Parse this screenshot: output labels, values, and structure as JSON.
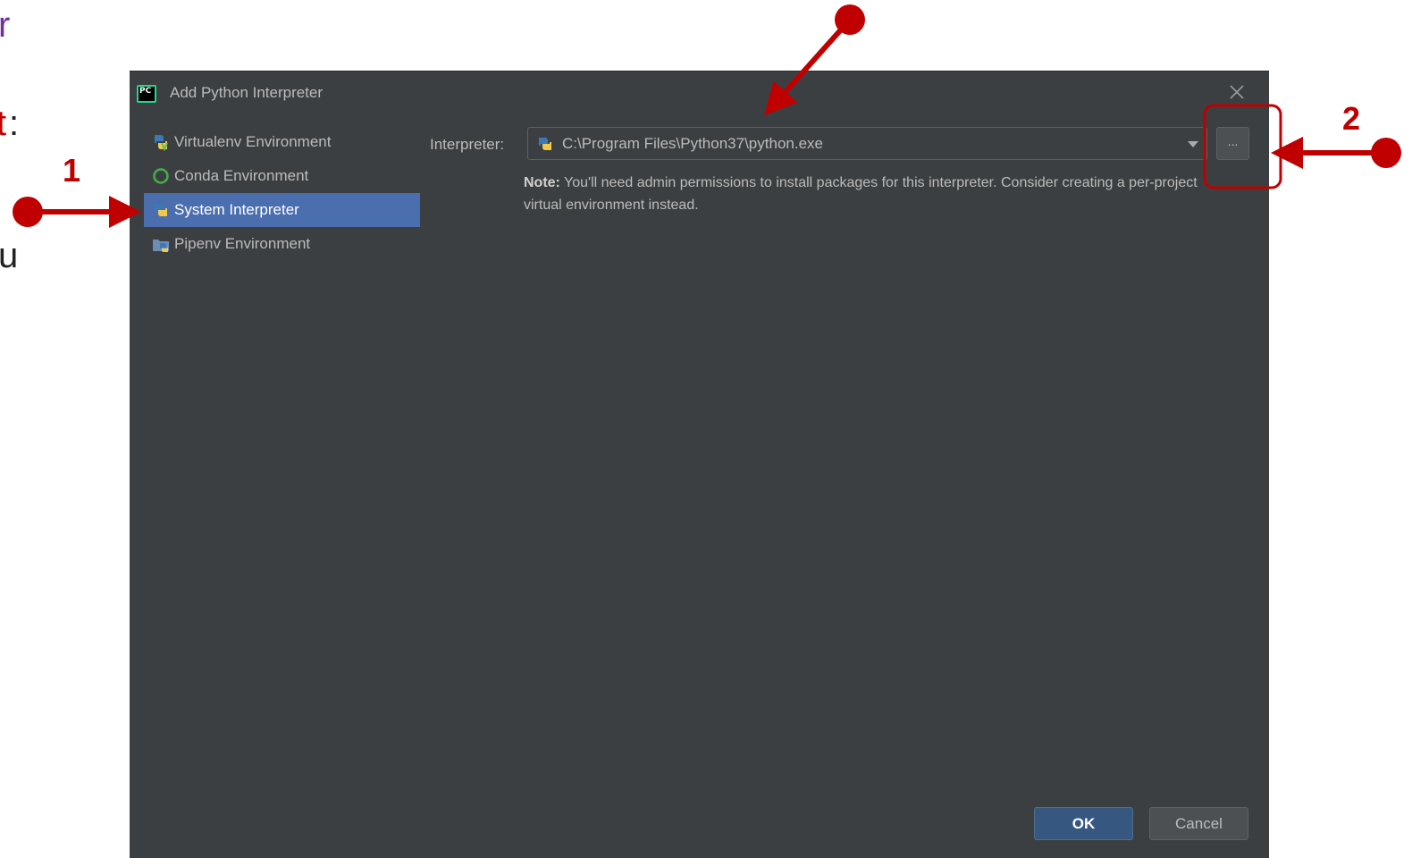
{
  "slide": {
    "fragment_r": "r",
    "fragment_t": "t",
    "fragment_colon": ":",
    "fragment_u": "u"
  },
  "dialog": {
    "title": "Add Python Interpreter",
    "app_icon_text": "PC",
    "sidebar": {
      "items": [
        {
          "label": "Virtualenv Environment",
          "icon": "virtualenv-icon",
          "selected": false
        },
        {
          "label": "Conda Environment",
          "icon": "conda-icon",
          "selected": false
        },
        {
          "label": "System Interpreter",
          "icon": "python-icon",
          "selected": true
        },
        {
          "label": "Pipenv Environment",
          "icon": "pipenv-icon",
          "selected": false
        }
      ]
    },
    "interpreter": {
      "label": "Interpreter:",
      "value": "C:\\Program Files\\Python37\\python.exe",
      "browse_label": "..."
    },
    "note": {
      "bold": "Note:",
      "text": " You'll need admin permissions to install packages for this interpreter. Consider creating a per-project virtual environment instead."
    },
    "buttons": {
      "ok": "OK",
      "cancel": "Cancel"
    }
  },
  "annotations": {
    "callout_1": "1",
    "callout_2": "2",
    "color": "#c00000"
  },
  "colors": {
    "dialog_bg": "#3c3f41",
    "selected_bg": "#4b6eaf",
    "ok_bg": "#365880",
    "text": "#bbbbbb"
  }
}
